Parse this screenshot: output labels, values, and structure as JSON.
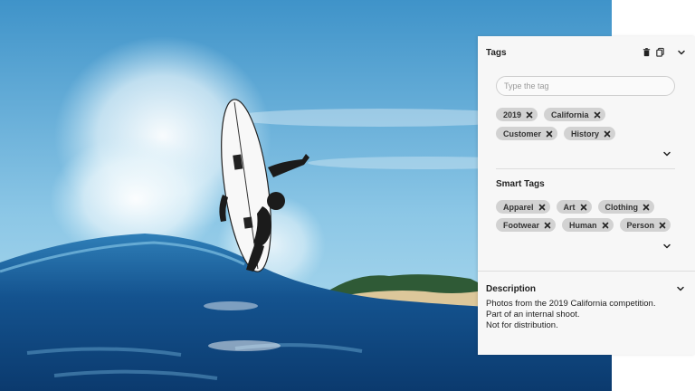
{
  "tags_section": {
    "title": "Tags",
    "input_placeholder": "Type the tag",
    "tags": [
      "2019",
      "California",
      "Customer",
      "History"
    ]
  },
  "smart_tags_section": {
    "title": "Smart Tags",
    "tags": [
      "Apparel",
      "Art",
      "Clothing",
      "Footwear",
      "Human",
      "Person"
    ]
  },
  "description_section": {
    "title": "Description",
    "lines": [
      "Photos from the 2019 California competition.",
      "Part of an internal shoot.",
      "Not for distribution."
    ]
  },
  "icons": {
    "delete": "trash-icon",
    "copy": "copy-icon",
    "expand": "chevron-down-icon",
    "remove_tag": "close-icon"
  },
  "colors": {
    "panel_bg": "#f7f7f7",
    "chip_bg": "#d2d2d2",
    "text": "#222222"
  }
}
